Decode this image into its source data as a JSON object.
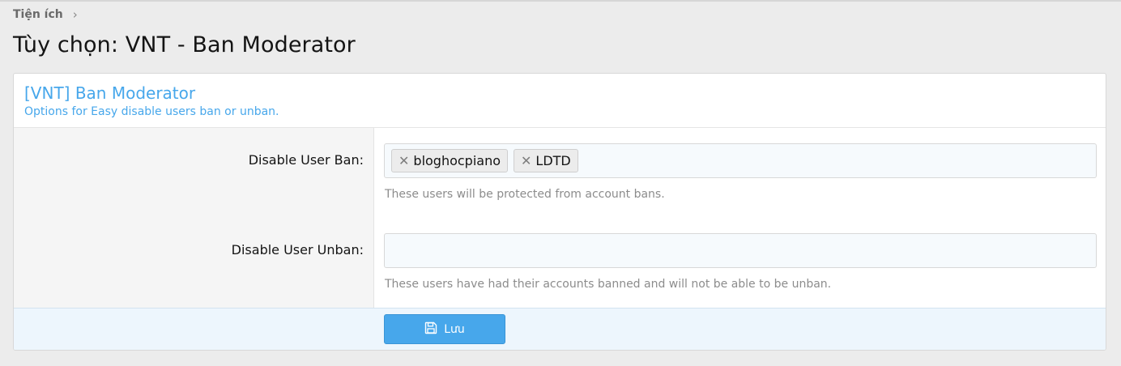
{
  "breadcrumb": {
    "item": "Tiện ích"
  },
  "page": {
    "title": "Tùy chọn: VNT - Ban Moderator"
  },
  "block": {
    "title": "[VNT] Ban Moderator",
    "description": "Options for Easy disable users ban or unban."
  },
  "fields": [
    {
      "label": "Disable User Ban:",
      "tokens": [
        "bloghocpiano",
        "LDTD"
      ],
      "hint": "These users will be protected from account bans."
    },
    {
      "label": "Disable User Unban:",
      "tokens": [],
      "hint": "These users have had their accounts banned and will not be able to be unban."
    }
  ],
  "footer": {
    "save_label": "Lưu"
  },
  "icons": {
    "remove_token": "close-icon",
    "save": "save-icon",
    "breadcrumb_separator": "chevron-right-icon"
  },
  "colors": {
    "accent": "#47a7eb",
    "page_bg": "#ececec"
  }
}
